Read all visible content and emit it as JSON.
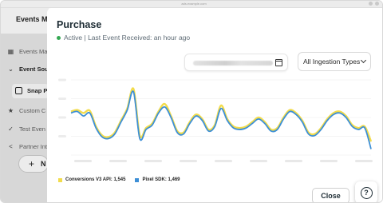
{
  "browser": {
    "url": "ads.example.com"
  },
  "sidebar": {
    "title": "Events Ma",
    "items": [
      {
        "label": "Events Ma",
        "icon": "grid-icon"
      },
      {
        "label": "Event Sour",
        "icon": "chevron-down-icon"
      },
      {
        "label": "Snap P",
        "icon": "pixel-icon"
      },
      {
        "label": "Custom C",
        "icon": "star-icon"
      },
      {
        "label": "Test Even",
        "icon": "check-circle-icon"
      },
      {
        "label": "Partner Int",
        "icon": "share-icon"
      }
    ],
    "add_label": "N"
  },
  "modal": {
    "title": "Purchase",
    "status": "Active | Last Event Received: an hour ago",
    "ingestion_select": "All Ingestion Types",
    "close_label": "Close"
  },
  "colors": {
    "conversions": "#f2dc4c",
    "pixel": "#3d8fd6",
    "status": "#35a853"
  },
  "chart_data": {
    "type": "line",
    "x": [
      0,
      1,
      2,
      3,
      4,
      5,
      6,
      7,
      8,
      9,
      10,
      11,
      12,
      13,
      14,
      15,
      16,
      17,
      18,
      19,
      20,
      21,
      22,
      23,
      24,
      25,
      26,
      27,
      28,
      29,
      30,
      31,
      32,
      33,
      34,
      35,
      36,
      37,
      38,
      39,
      40,
      41,
      42,
      43,
      44,
      45,
      46,
      47,
      48
    ],
    "series": [
      {
        "name": "Conversions V3 API: 1,545",
        "color": "#f2dc4c",
        "values": [
          58,
          60,
          56,
          59,
          38,
          26,
          24,
          30,
          46,
          62,
          88,
          26,
          36,
          42,
          58,
          68,
          52,
          32,
          30,
          44,
          54,
          48,
          34,
          40,
          66,
          48,
          38,
          36,
          38,
          44,
          50,
          44,
          34,
          36,
          50,
          60,
          56,
          46,
          30,
          28,
          36,
          48,
          56,
          58,
          52,
          40,
          36,
          38,
          18
        ]
      },
      {
        "name": "Pixel SDK: 1,469",
        "color": "#3d8fd6",
        "values": [
          56,
          58,
          52,
          56,
          36,
          24,
          22,
          28,
          44,
          60,
          84,
          22,
          34,
          40,
          56,
          64,
          50,
          30,
          28,
          42,
          52,
          46,
          32,
          38,
          62,
          46,
          36,
          34,
          36,
          42,
          48,
          42,
          32,
          34,
          48,
          58,
          54,
          44,
          28,
          26,
          34,
          46,
          54,
          56,
          50,
          38,
          34,
          36,
          8
        ]
      }
    ],
    "ylim": [
      0,
      100
    ],
    "grid": true
  }
}
